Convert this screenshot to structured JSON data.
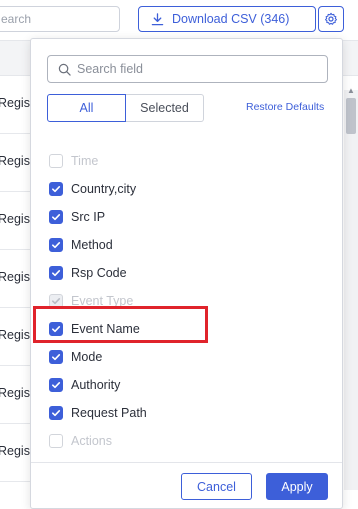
{
  "toolbar": {
    "search_placeholder": "earch",
    "download_label": "Download CSV (346)"
  },
  "background_rows": [
    "Regist",
    "Regist",
    "Regist",
    "Regist",
    "Regist",
    "Regist",
    "Regist"
  ],
  "panel": {
    "search_placeholder": "Search field",
    "tabs": {
      "all": "All",
      "selected": "Selected",
      "active": "All"
    },
    "restore_label": "Restore Defaults",
    "fields": [
      {
        "label": "Time",
        "checked": false,
        "disabled": true
      },
      {
        "label": "Country,city",
        "checked": true,
        "disabled": false
      },
      {
        "label": "Src IP",
        "checked": true,
        "disabled": false
      },
      {
        "label": "Method",
        "checked": true,
        "disabled": false
      },
      {
        "label": "Rsp Code",
        "checked": true,
        "disabled": false
      },
      {
        "label": "Event Type",
        "checked": true,
        "disabled": true
      },
      {
        "label": "Event Name",
        "checked": true,
        "disabled": false,
        "highlighted": true
      },
      {
        "label": "Mode",
        "checked": true,
        "disabled": false
      },
      {
        "label": "Authority",
        "checked": true,
        "disabled": false
      },
      {
        "label": "Request Path",
        "checked": true,
        "disabled": false
      },
      {
        "label": "Actions",
        "checked": false,
        "disabled": true
      }
    ],
    "cancel_label": "Cancel",
    "apply_label": "Apply"
  },
  "colors": {
    "accent": "#3d5fd9",
    "highlight": "#e0232b",
    "disabled_text": "#c3c6cd"
  }
}
